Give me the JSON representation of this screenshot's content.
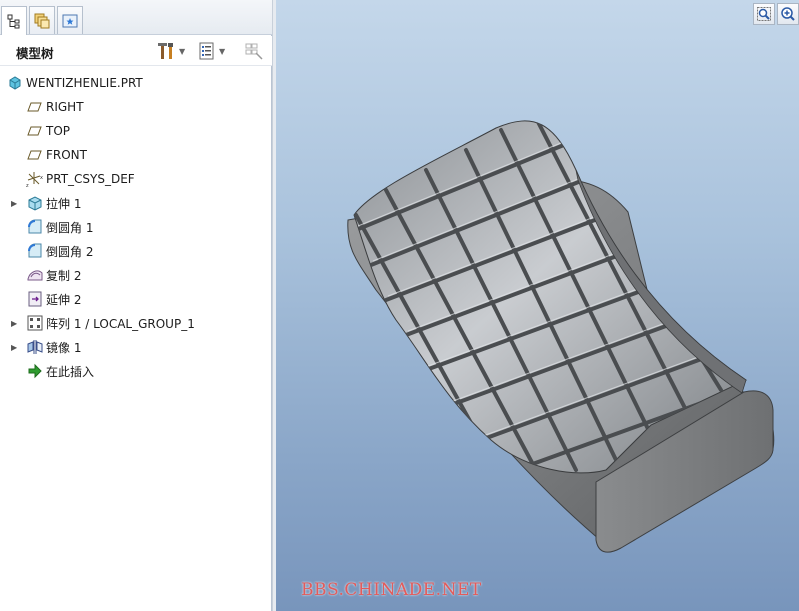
{
  "tabs": [
    {
      "icon": "model-tree-icon"
    },
    {
      "icon": "folder-browser-icon"
    },
    {
      "icon": "favorites-icon"
    }
  ],
  "panel": {
    "title": "模型树",
    "tools": [
      {
        "icon": "tree-settings-icon",
        "has_dropdown": true
      },
      {
        "icon": "tree-filter-icon",
        "has_dropdown": true
      },
      {
        "icon": "column-display-icon",
        "has_dropdown": false
      }
    ]
  },
  "tree": [
    {
      "label": "WENTIZHENLIE.PRT",
      "icon": "part-icon",
      "expandable": false
    },
    {
      "label": "RIGHT",
      "icon": "datum-plane-icon",
      "expandable": false
    },
    {
      "label": "TOP",
      "icon": "datum-plane-icon",
      "expandable": false
    },
    {
      "label": "FRONT",
      "icon": "datum-plane-icon",
      "expandable": false
    },
    {
      "label": "PRT_CSYS_DEF",
      "icon": "coordinate-system-icon",
      "expandable": false
    },
    {
      "label": "拉伸 1",
      "icon": "extrude-icon",
      "expandable": true
    },
    {
      "label": "倒圆角 1",
      "icon": "round-icon",
      "expandable": false
    },
    {
      "label": "倒圆角 2",
      "icon": "round-icon",
      "expandable": false
    },
    {
      "label": "复制 2",
      "icon": "copy-surface-icon",
      "expandable": false
    },
    {
      "label": "延伸 2",
      "icon": "extend-icon",
      "expandable": false
    },
    {
      "label": "阵列 1 / LOCAL_GROUP_1",
      "icon": "pattern-icon",
      "expandable": true
    },
    {
      "label": "镜像 1",
      "icon": "mirror-icon",
      "expandable": true
    },
    {
      "label": "在此插入",
      "icon": "insert-here-icon",
      "expandable": false
    }
  ],
  "viewport": {
    "tools": [
      {
        "icon": "zoom-window-icon"
      },
      {
        "icon": "zoom-in-icon"
      }
    ],
    "watermark": "BBS.CHINADE.NET"
  }
}
